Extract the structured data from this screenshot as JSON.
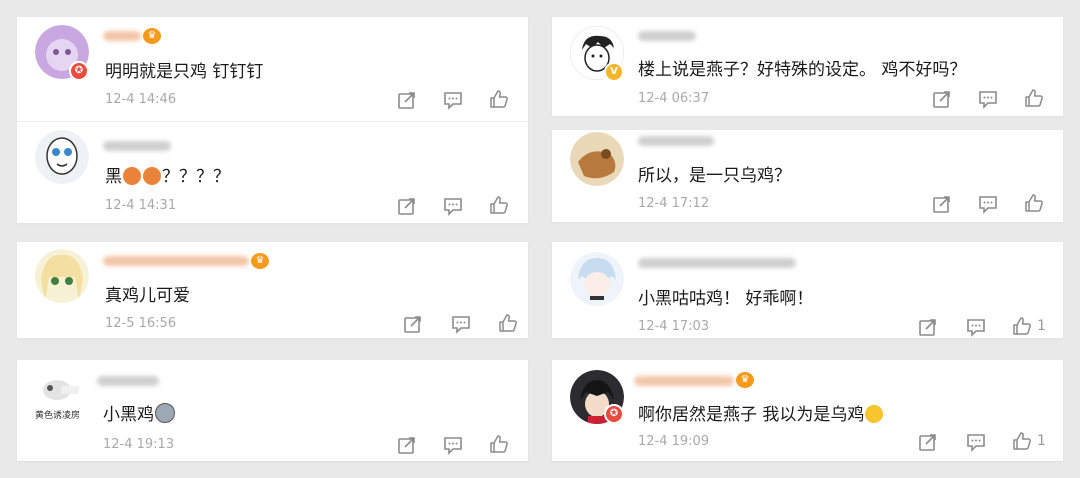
{
  "comments": [
    {
      "text": "明明就是只鸡 钉钉钉",
      "time": "12-4 14:46",
      "likes": ""
    },
    {
      "text": "黑",
      "text_after": "？？？？",
      "time": "12-4 14:31",
      "likes": ""
    },
    {
      "text": "真鸡儿可爱",
      "time": "12-5 16:56",
      "likes": ""
    },
    {
      "text": "小黑鸡",
      "time": "12-4 19:13",
      "likes": ""
    },
    {
      "text": "楼上说是燕子？好特殊的设定。 鸡不好吗？",
      "time": "12-4 06:37",
      "likes": ""
    },
    {
      "text": "所以，是一只乌鸡？",
      "time": "12-4 17:12",
      "likes": ""
    },
    {
      "text": "小黑咕咕鸡！ 好乖啊！",
      "time": "12-4 17:03",
      "likes": "1"
    },
    {
      "text": "啊你居然是燕子 我以为是乌鸡",
      "time": "12-4 19:09",
      "likes": "1"
    }
  ],
  "avatar4_text": "黄色诱凌房",
  "badges": {
    "red": "✪",
    "gold": "V"
  },
  "icons": {
    "repost": "repost-icon",
    "comment": "comment-icon",
    "like": "thumbs-up-icon",
    "vip": "crown-icon"
  },
  "colors": {
    "background": "#e9e9e9",
    "card": "#ffffff",
    "time": "#a9a9a9",
    "icon": "#8c8c8c",
    "crown": "#f59a1b"
  }
}
